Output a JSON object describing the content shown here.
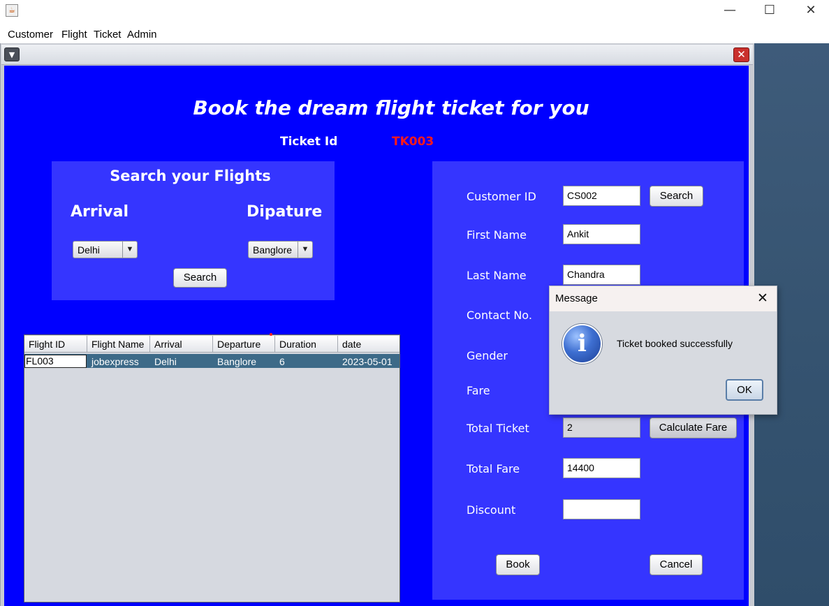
{
  "menubar": {
    "items": [
      "Customer",
      "Flight",
      "Ticket",
      "Admin"
    ]
  },
  "window_controls": {
    "minimize": "—",
    "maximize": "☐",
    "close": "✕"
  },
  "heading": "Book the dream flight ticket for you",
  "ticket": {
    "label": "Ticket Id",
    "value": "TK003",
    "value_color": "#ff1a1a"
  },
  "search": {
    "title": "Search your Flights",
    "arrival_label": "Arrival",
    "departure_label": "Dipature",
    "arrival_value": "Delhi",
    "departure_value": "Banglore",
    "button": "Search"
  },
  "table": {
    "columns": [
      "Flight ID",
      "Flight Name",
      "Arrival",
      "Departure",
      "Duration",
      "date"
    ],
    "rows": [
      [
        "FL003",
        "jobexpress",
        "Delhi",
        "Banglore",
        "6",
        "2023-05-01"
      ]
    ]
  },
  "form": {
    "customer_id_label": "Customer ID",
    "customer_id": "CS002",
    "search_button": "Search",
    "first_name_label": "First Name",
    "first_name": "Ankit",
    "last_name_label": "Last Name",
    "last_name": "Chandra",
    "contact_label": "Contact No.",
    "gender_label": "Gender",
    "fare_label": "Fare",
    "total_ticket_label": "Total Ticket",
    "total_ticket": "2",
    "calc_button": "Calculate Fare",
    "total_fare_label": "Total Fare",
    "total_fare": "14400",
    "discount_label": "Discount",
    "discount": "",
    "book_button": "Book",
    "cancel_button": "Cancel"
  },
  "dialog": {
    "title": "Message",
    "close": "✕",
    "message": "Ticket booked successfully",
    "ok": "OK",
    "icon": "i"
  },
  "colors": {
    "content_bg": "#0000ff",
    "panel_bg": "#3535ff",
    "selected_row": "#3d6a88"
  }
}
